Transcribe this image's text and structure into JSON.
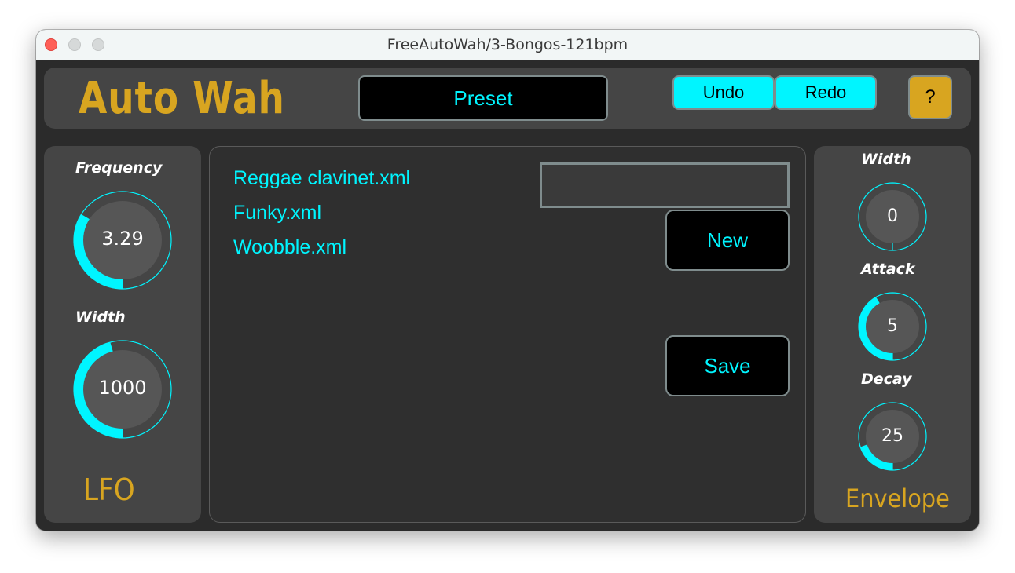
{
  "window": {
    "title": "FreeAutoWah/3-Bongos-121bpm"
  },
  "header": {
    "app_name": "Auto Wah",
    "preset_label": "Preset",
    "undo_label": "Undo",
    "redo_label": "Redo",
    "help_label": "?"
  },
  "lfo": {
    "section_label": "LFO",
    "knobs": [
      {
        "label": "Frequency",
        "value": "3.29",
        "level": 0.34
      },
      {
        "label": "Width",
        "value": "1000",
        "level": 0.46
      }
    ]
  },
  "presets": {
    "files": [
      "Reggae clavinet.xml",
      "Funky.xml",
      "Woobble.xml"
    ],
    "name_value": "",
    "new_label": "New",
    "save_label": "Save"
  },
  "envelope": {
    "section_label": "Envelope",
    "knobs": [
      {
        "label": "Width",
        "value": "0",
        "level": 0.0
      },
      {
        "label": "Attack",
        "value": "5",
        "level": 0.42
      },
      {
        "label": "Decay",
        "value": "25",
        "level": 0.2
      }
    ]
  },
  "colors": {
    "accent": "#00f5ff",
    "brand": "#d8a520",
    "panel": "#454545",
    "background": "#2b2b2b"
  }
}
